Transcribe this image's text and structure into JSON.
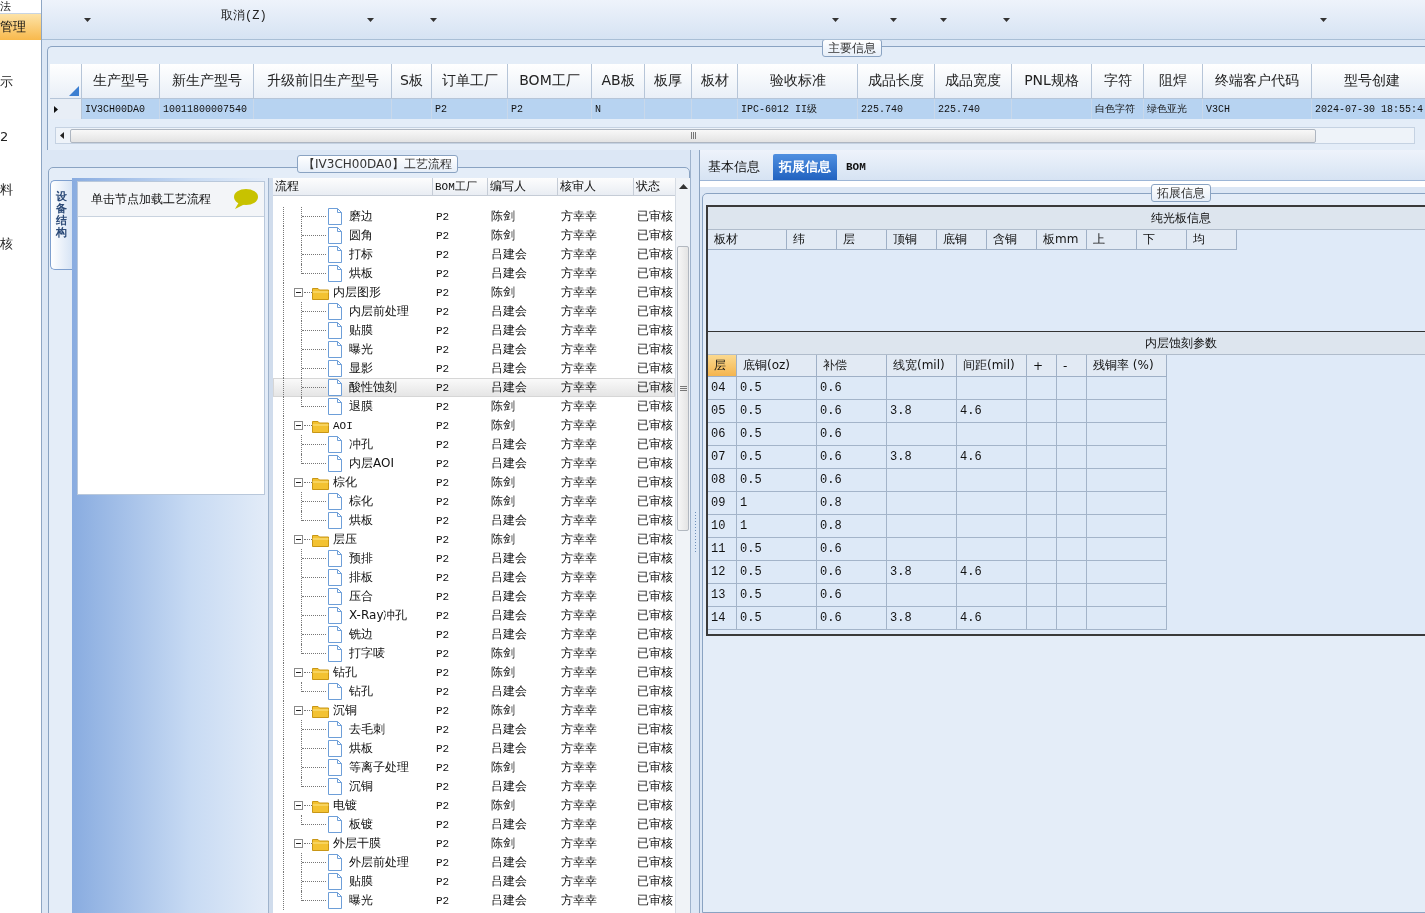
{
  "nav": {
    "items": [
      {
        "label": "法",
        "selected": false
      },
      {
        "label": "管理",
        "selected": true
      },
      {
        "label": "示",
        "selected": false
      },
      {
        "label": "2",
        "selected": false
      },
      {
        "label": "料",
        "selected": false
      },
      {
        "label": "核",
        "selected": false
      }
    ]
  },
  "ribbon": {
    "buttons": [
      "取消(Z)"
    ]
  },
  "main_info": {
    "title": "主要信息",
    "columns": [
      "生产型号",
      "新生产型号",
      "升级前旧生产型号",
      "S板",
      "订单工厂",
      "BOM工厂",
      "AB板",
      "板厚",
      "板材",
      "验收标准",
      "成品长度",
      "成品宽度",
      "PNL规格",
      "字符",
      "阻焊",
      "终端客户代码",
      "型号创建"
    ],
    "rows": [
      {
        "selected": true,
        "cells": [
          "IV3CH00DA0",
          "10011800007540",
          null,
          null,
          "P2",
          "P2",
          "N",
          null,
          null,
          "IPC-6012 II级",
          "225.740",
          "225.740",
          null,
          "白色字符",
          "绿色亚光",
          "V3CH",
          "2024-07-30 18:55:4"
        ]
      }
    ]
  },
  "flow_panel": {
    "title": "【IV3CH00DA0】工艺流程",
    "side_tab": "设备结构",
    "hint": "单击节点加载工艺流程",
    "columns": [
      "流程",
      "BOM工厂",
      "编写人",
      "核审人",
      "状态"
    ],
    "rows": [
      {
        "kind": "continued",
        "children": [
          {
            "name": "磨边",
            "bom_factory": "P2",
            "author": "陈剑",
            "reviewer": "方幸幸",
            "status": "已审核",
            "selected": false
          },
          {
            "name": "圆角",
            "bom_factory": "P2",
            "author": "陈剑",
            "reviewer": "方幸幸",
            "status": "已审核",
            "selected": false
          },
          {
            "name": "打标",
            "bom_factory": "P2",
            "author": "吕建会",
            "reviewer": "方幸幸",
            "status": "已审核",
            "selected": false
          },
          {
            "name": "烘板",
            "bom_factory": "P2",
            "author": "吕建会",
            "reviewer": "方幸幸",
            "status": "已审核",
            "selected": false
          }
        ]
      },
      {
        "kind": "group",
        "name": "内层图形",
        "bom_factory": "P2",
        "author": "陈剑",
        "reviewer": "方幸幸",
        "status": "已审核",
        "expanded": true,
        "selected": false,
        "children": [
          {
            "name": "内层前处理",
            "bom_factory": "P2",
            "author": "吕建会",
            "reviewer": "方幸幸",
            "status": "已审核",
            "selected": false
          },
          {
            "name": "贴膜",
            "bom_factory": "P2",
            "author": "吕建会",
            "reviewer": "方幸幸",
            "status": "已审核",
            "selected": false
          },
          {
            "name": "曝光",
            "bom_factory": "P2",
            "author": "吕建会",
            "reviewer": "方幸幸",
            "status": "已审核",
            "selected": false
          },
          {
            "name": "显影",
            "bom_factory": "P2",
            "author": "吕建会",
            "reviewer": "方幸幸",
            "status": "已审核",
            "selected": false
          },
          {
            "name": "酸性蚀刻",
            "bom_factory": "P2",
            "author": "吕建会",
            "reviewer": "方幸幸",
            "status": "已审核",
            "selected": true
          },
          {
            "name": "退膜",
            "bom_factory": "P2",
            "author": "陈剑",
            "reviewer": "方幸幸",
            "status": "已审核",
            "selected": false
          }
        ]
      },
      {
        "kind": "group",
        "name": "AOI",
        "bom_factory": "P2",
        "author": "陈剑",
        "reviewer": "方幸幸",
        "status": "已审核",
        "expanded": true,
        "selected": false,
        "children": [
          {
            "name": "冲孔",
            "bom_factory": "P2",
            "author": "吕建会",
            "reviewer": "方幸幸",
            "status": "已审核",
            "selected": false
          },
          {
            "name": "内层AOI",
            "bom_factory": "P2",
            "author": "吕建会",
            "reviewer": "方幸幸",
            "status": "已审核",
            "selected": false
          }
        ]
      },
      {
        "kind": "group",
        "name": "棕化",
        "bom_factory": "P2",
        "author": "陈剑",
        "reviewer": "方幸幸",
        "status": "已审核",
        "expanded": true,
        "selected": false,
        "children": [
          {
            "name": "棕化",
            "bom_factory": "P2",
            "author": "陈剑",
            "reviewer": "方幸幸",
            "status": "已审核",
            "selected": false
          },
          {
            "name": "烘板",
            "bom_factory": "P2",
            "author": "吕建会",
            "reviewer": "方幸幸",
            "status": "已审核",
            "selected": false
          }
        ]
      },
      {
        "kind": "group",
        "name": "层压",
        "bom_factory": "P2",
        "author": "陈剑",
        "reviewer": "方幸幸",
        "status": "已审核",
        "expanded": true,
        "selected": false,
        "children": [
          {
            "name": "预排",
            "bom_factory": "P2",
            "author": "吕建会",
            "reviewer": "方幸幸",
            "status": "已审核",
            "selected": false
          },
          {
            "name": "排板",
            "bom_factory": "P2",
            "author": "吕建会",
            "reviewer": "方幸幸",
            "status": "已审核",
            "selected": false
          },
          {
            "name": "压合",
            "bom_factory": "P2",
            "author": "吕建会",
            "reviewer": "方幸幸",
            "status": "已审核",
            "selected": false
          },
          {
            "name": "X-Ray冲孔",
            "bom_factory": "P2",
            "author": "吕建会",
            "reviewer": "方幸幸",
            "status": "已审核",
            "selected": false
          },
          {
            "name": "铣边",
            "bom_factory": "P2",
            "author": "吕建会",
            "reviewer": "方幸幸",
            "status": "已审核",
            "selected": false
          },
          {
            "name": "打字唛",
            "bom_factory": "P2",
            "author": "陈剑",
            "reviewer": "方幸幸",
            "status": "已审核",
            "selected": false
          }
        ]
      },
      {
        "kind": "group",
        "name": "钻孔",
        "bom_factory": "P2",
        "author": "陈剑",
        "reviewer": "方幸幸",
        "status": "已审核",
        "expanded": true,
        "selected": false,
        "children": [
          {
            "name": "钻孔",
            "bom_factory": "P2",
            "author": "吕建会",
            "reviewer": "方幸幸",
            "status": "已审核",
            "selected": false
          }
        ]
      },
      {
        "kind": "group",
        "name": "沉铜",
        "bom_factory": "P2",
        "author": "陈剑",
        "reviewer": "方幸幸",
        "status": "已审核",
        "expanded": true,
        "selected": false,
        "children": [
          {
            "name": "去毛刺",
            "bom_factory": "P2",
            "author": "吕建会",
            "reviewer": "方幸幸",
            "status": "已审核",
            "selected": false
          },
          {
            "name": "烘板",
            "bom_factory": "P2",
            "author": "吕建会",
            "reviewer": "方幸幸",
            "status": "已审核",
            "selected": false
          },
          {
            "name": "等离子处理",
            "bom_factory": "P2",
            "author": "陈剑",
            "reviewer": "方幸幸",
            "status": "已审核",
            "selected": false
          },
          {
            "name": "沉铜",
            "bom_factory": "P2",
            "author": "吕建会",
            "reviewer": "方幸幸",
            "status": "已审核",
            "selected": false
          }
        ]
      },
      {
        "kind": "group",
        "name": "电镀",
        "bom_factory": "P2",
        "author": "陈剑",
        "reviewer": "方幸幸",
        "status": "已审核",
        "expanded": true,
        "selected": false,
        "children": [
          {
            "name": "板镀",
            "bom_factory": "P2",
            "author": "吕建会",
            "reviewer": "方幸幸",
            "status": "已审核",
            "selected": false
          }
        ]
      },
      {
        "kind": "group",
        "name": "外层干膜",
        "bom_factory": "P2",
        "author": "陈剑",
        "reviewer": "方幸幸",
        "status": "已审核",
        "expanded": true,
        "selected": false,
        "children": [
          {
            "name": "外层前处理",
            "bom_factory": "P2",
            "author": "吕建会",
            "reviewer": "方幸幸",
            "status": "已审核",
            "selected": false
          },
          {
            "name": "贴膜",
            "bom_factory": "P2",
            "author": "吕建会",
            "reviewer": "方幸幸",
            "status": "已审核",
            "selected": false
          },
          {
            "name": "曝光",
            "bom_factory": "P2",
            "author": "吕建会",
            "reviewer": "方幸幸",
            "status": "已审核",
            "selected": false
          }
        ]
      }
    ]
  },
  "ext_panel": {
    "tabs": [
      {
        "label": "基本信息",
        "selected": false
      },
      {
        "label": "拓展信息",
        "selected": true
      },
      {
        "label": "BOM",
        "selected": false
      }
    ],
    "group_title": "拓展信息",
    "bare_board": {
      "title": "纯光板信息",
      "columns": [
        "板材",
        "纬",
        "层",
        "顶铜",
        "底铜",
        "含铜",
        "板mm",
        "上",
        "下",
        "均"
      ]
    },
    "inner_etch": {
      "title": "内层蚀刻参数",
      "columns": [
        {
          "label": "层",
          "selected": true
        },
        {
          "label": "底铜(oz)",
          "selected": false
        },
        {
          "label": "补偿",
          "selected": false
        },
        {
          "label": "线宽(mil)",
          "selected": false
        },
        {
          "label": "间距(mil)",
          "selected": false
        },
        {
          "label": "+",
          "selected": false
        },
        {
          "label": "-",
          "selected": false
        },
        {
          "label": "残铜率 (%)",
          "selected": false
        }
      ],
      "rows": [
        [
          "04",
          "0.5",
          "0.6",
          null,
          null,
          null,
          null,
          null
        ],
        [
          "05",
          "0.5",
          "0.6",
          "3.8",
          "4.6",
          null,
          null,
          null
        ],
        [
          "06",
          "0.5",
          "0.6",
          null,
          null,
          null,
          null,
          null
        ],
        [
          "07",
          "0.5",
          "0.6",
          "3.8",
          "4.6",
          null,
          null,
          null
        ],
        [
          "08",
          "0.5",
          "0.6",
          null,
          null,
          null,
          null,
          null
        ],
        [
          "09",
          "1",
          "0.8",
          null,
          null,
          null,
          null,
          null
        ],
        [
          "10",
          "1",
          "0.8",
          null,
          null,
          null,
          null,
          null
        ],
        [
          "11",
          "0.5",
          "0.6",
          null,
          null,
          null,
          null,
          null
        ],
        [
          "12",
          "0.5",
          "0.6",
          "3.8",
          "4.6",
          null,
          null,
          null
        ],
        [
          "13",
          "0.5",
          "0.6",
          null,
          null,
          null,
          null,
          null
        ],
        [
          "14",
          "0.5",
          "0.6",
          "3.8",
          "4.6",
          null,
          null,
          null
        ]
      ]
    }
  }
}
